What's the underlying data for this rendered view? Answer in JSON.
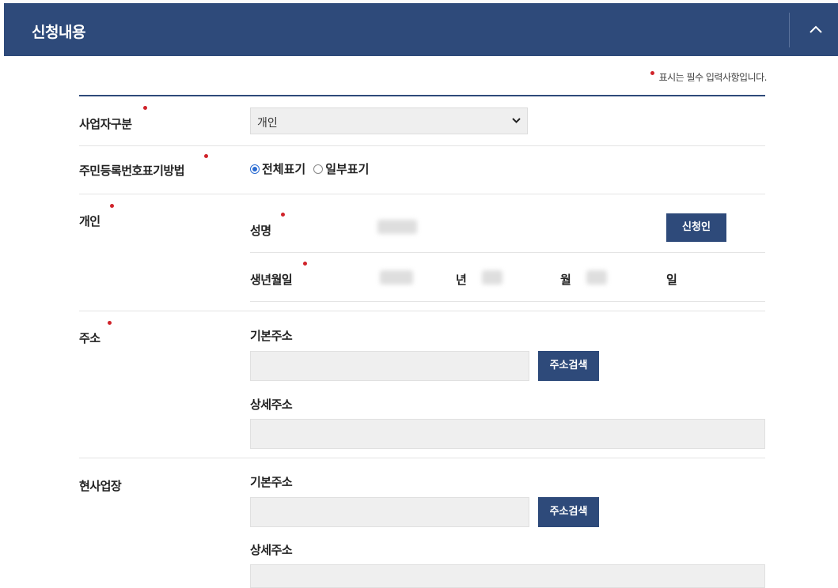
{
  "section": {
    "title": "신청내용"
  },
  "required_note": "표시는 필수 입력사항입니다.",
  "business_type": {
    "label": "사업자구분",
    "selected": "개인"
  },
  "rrn_display": {
    "label": "주민등록번호표기방법",
    "options": [
      {
        "label": "전체표기",
        "checked": true
      },
      {
        "label": "일부표기",
        "checked": false
      }
    ]
  },
  "individual": {
    "label": "개인",
    "name_label": "성명",
    "applicant_button": "신청인",
    "birth_label": "생년월일",
    "year_unit": "년",
    "month_unit": "월",
    "day_unit": "일"
  },
  "address": {
    "label": "주소",
    "basic_label": "기본주소",
    "search_button": "주소검색",
    "detail_label": "상세주소"
  },
  "site": {
    "label": "현사업장",
    "basic_label": "기본주소",
    "search_button": "주소검색",
    "detail_label": "상세주소"
  },
  "colors": {
    "header": "#2e4a7a",
    "required": "#d0232a",
    "radio": "#2a6bd1"
  }
}
